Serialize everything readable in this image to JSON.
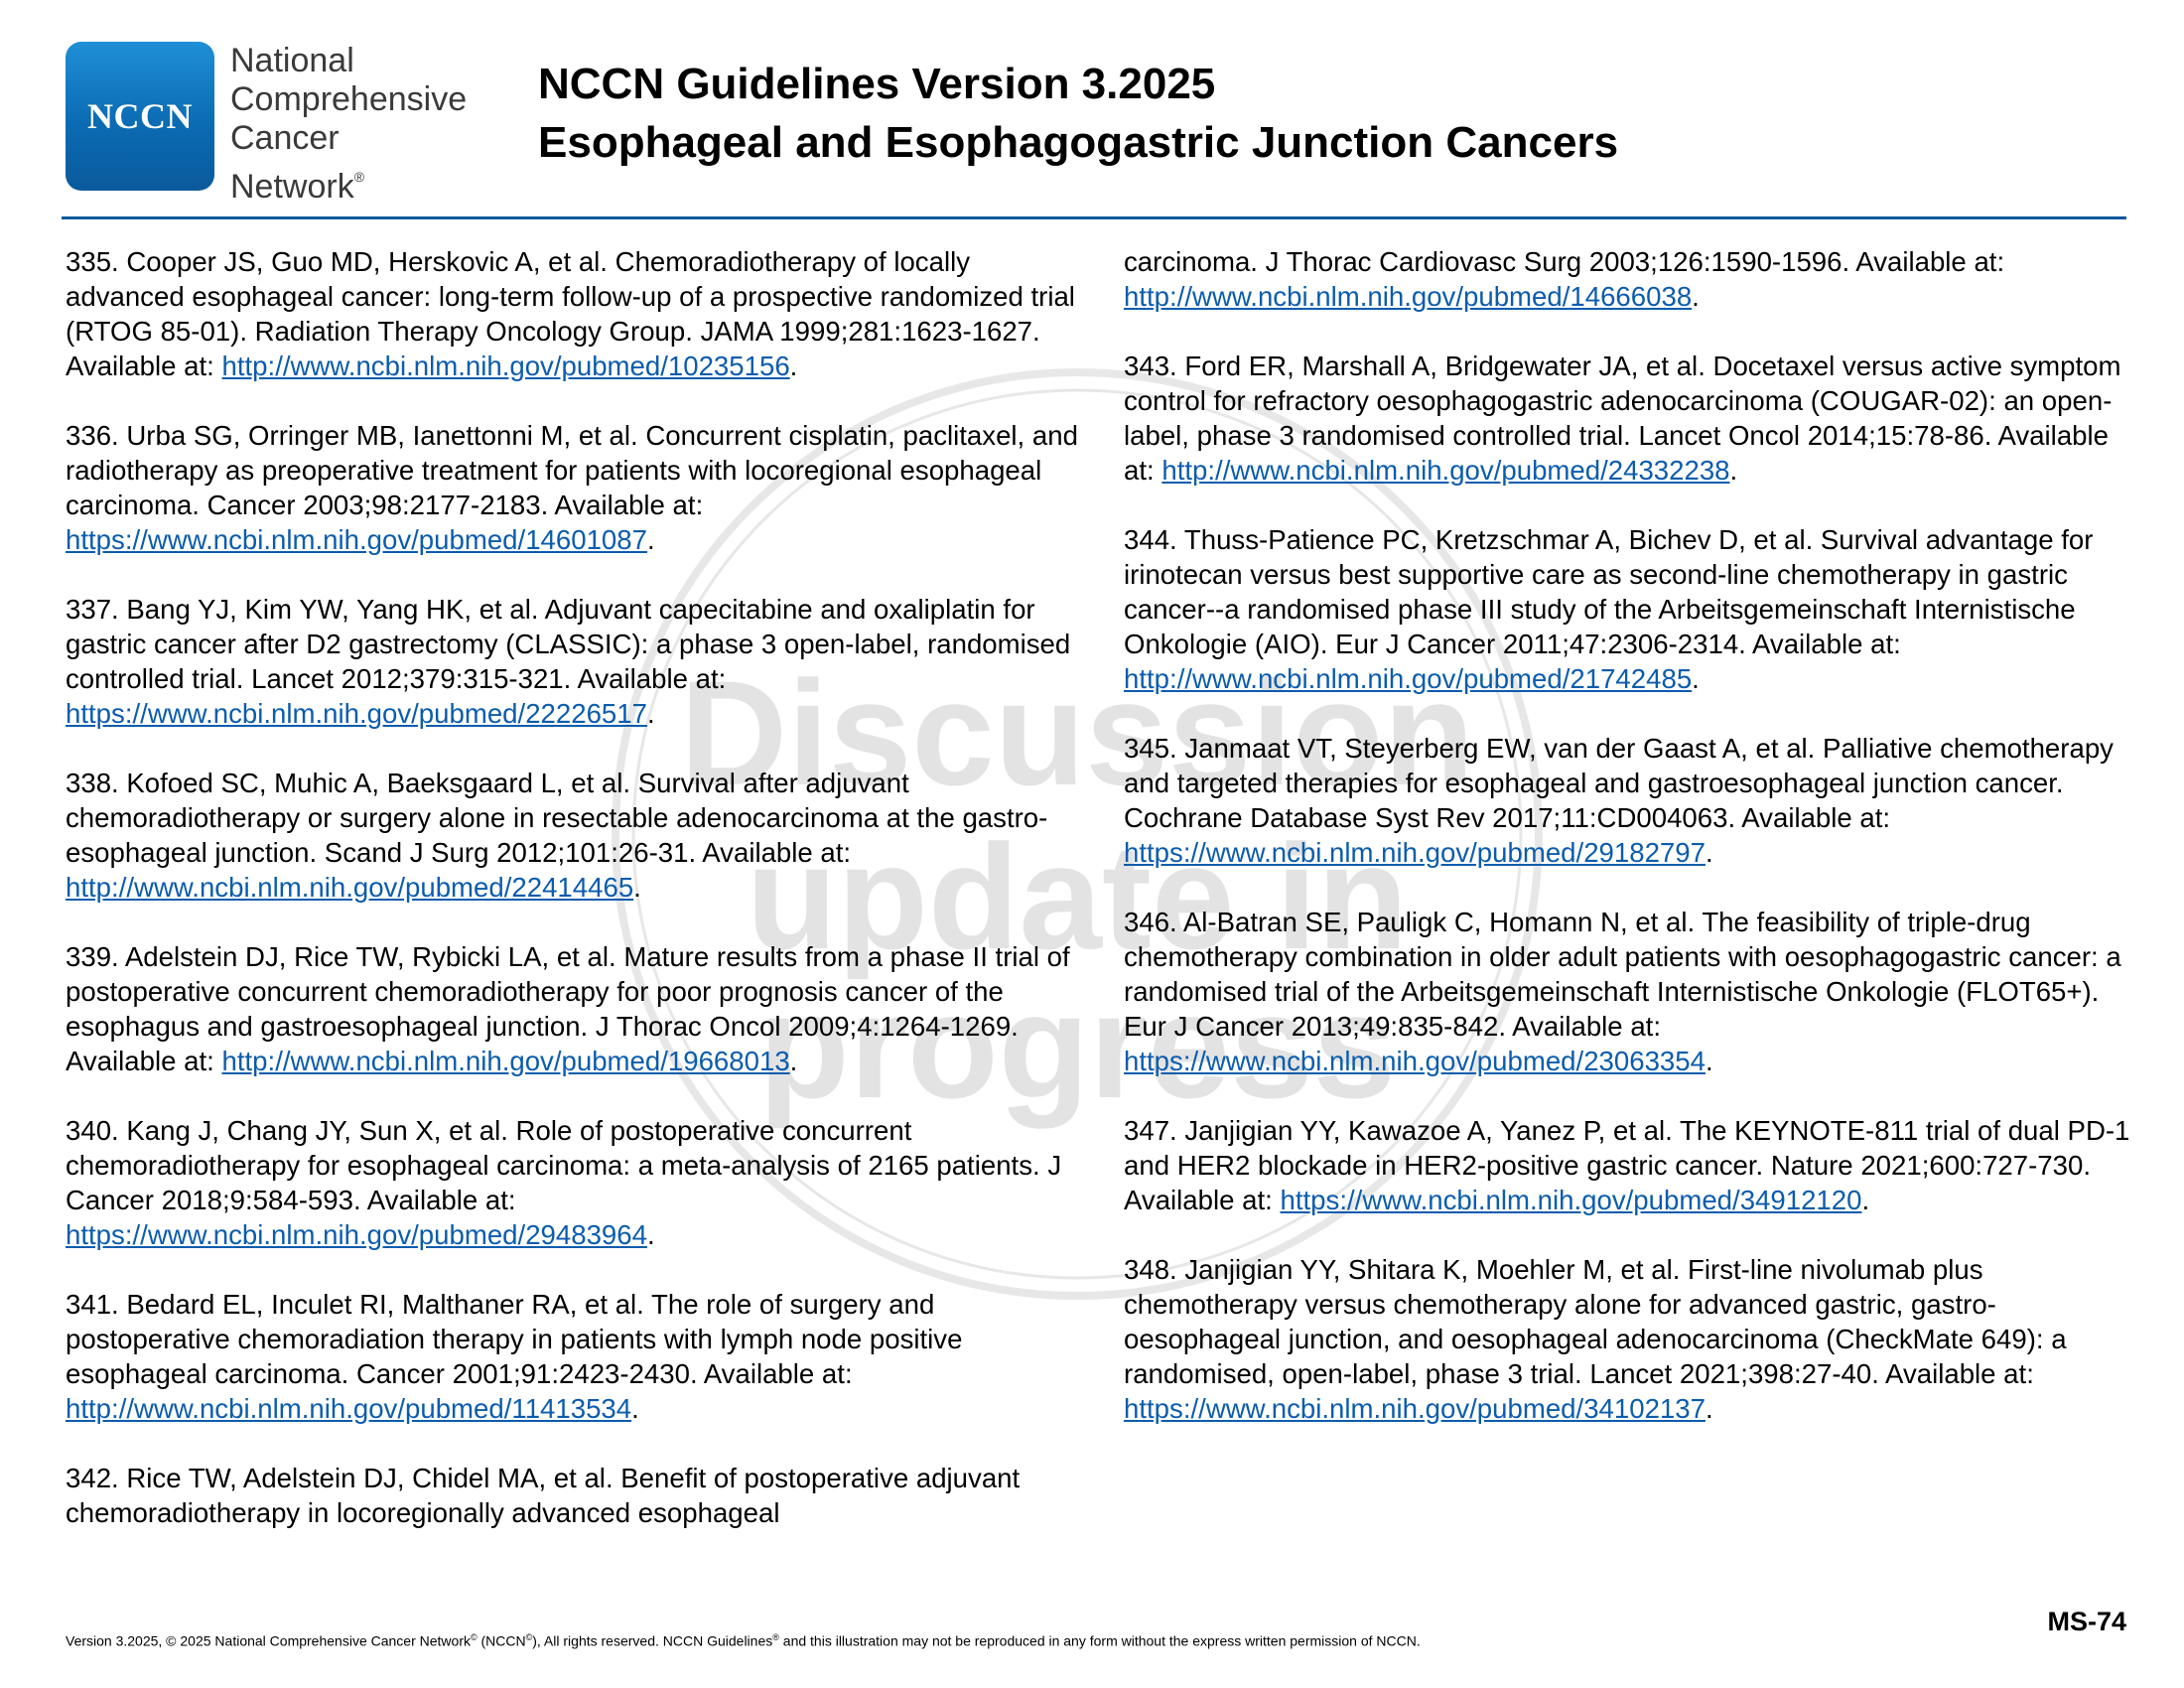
{
  "header": {
    "logo_text": "NCCN",
    "org_lines": [
      "National",
      "Comprehensive",
      "Cancer",
      "Network"
    ],
    "org_reg_mark": "®",
    "title_line1": "NCCN Guidelines Version 3.2025",
    "title_line2": "Esophageal and Esophagogastric Junction Cancers"
  },
  "watermark": {
    "lines": [
      "Discussion",
      "update in",
      "progress"
    ]
  },
  "left_column": [
    {
      "text": "335. Cooper JS, Guo MD, Herskovic A, et al. Chemoradiotherapy of locally advanced esophageal cancer: long-term follow-up of a prospective randomized trial (RTOG 85-01). Radiation Therapy Oncology Group. JAMA 1999;281:1623-1627. Available at: ",
      "link": "http://www.ncbi.nlm.nih.gov/pubmed/10235156",
      "end": "."
    },
    {
      "text": "336. Urba SG, Orringer MB, Ianettonni M, et al. Concurrent cisplatin, paclitaxel, and radiotherapy as preoperative treatment for patients with locoregional esophageal carcinoma. Cancer 2003;98:2177-2183. Available at: ",
      "link": "https://www.ncbi.nlm.nih.gov/pubmed/14601087",
      "end": "."
    },
    {
      "text": "337. Bang YJ, Kim YW, Yang HK, et al. Adjuvant capecitabine and oxaliplatin for gastric cancer after D2 gastrectomy (CLASSIC): a phase 3 open-label, randomised controlled trial. Lancet 2012;379:315-321. Available at: ",
      "link": "https://www.ncbi.nlm.nih.gov/pubmed/22226517",
      "end": "."
    },
    {
      "text": "338. Kofoed SC, Muhic A, Baeksgaard L, et al. Survival after adjuvant chemoradiotherapy or surgery alone in resectable adenocarcinoma at the gastro-esophageal junction. Scand J Surg 2012;101:26-31. Available at: ",
      "link": "http://www.ncbi.nlm.nih.gov/pubmed/22414465",
      "end": "."
    },
    {
      "text": "339. Adelstein DJ, Rice TW, Rybicki LA, et al. Mature results from a phase II trial of postoperative concurrent chemoradiotherapy for poor prognosis cancer of the esophagus and gastroesophageal junction. J Thorac Oncol 2009;4:1264-1269. Available at: ",
      "link": "http://www.ncbi.nlm.nih.gov/pubmed/19668013",
      "end": "."
    },
    {
      "text": "340. Kang J, Chang JY, Sun X, et al. Role of postoperative concurrent chemoradiotherapy for esophageal carcinoma: a meta-analysis of 2165 patients. J Cancer 2018;9:584-593. Available at: ",
      "link": "https://www.ncbi.nlm.nih.gov/pubmed/29483964",
      "end": "."
    },
    {
      "text": "341. Bedard EL, Inculet RI, Malthaner RA, et al. The role of surgery and postoperative chemoradiation therapy in patients with lymph node positive esophageal carcinoma. Cancer 2001;91:2423-2430. Available at: ",
      "link": "http://www.ncbi.nlm.nih.gov/pubmed/11413534",
      "end": "."
    },
    {
      "text": "342. Rice TW, Adelstein DJ, Chidel MA, et al. Benefit of postoperative adjuvant chemoradiotherapy in locoregionally advanced esophageal",
      "link": "",
      "end": ""
    }
  ],
  "right_column": [
    {
      "text": "carcinoma. J Thorac Cardiovasc Surg 2003;126:1590-1596. Available at: ",
      "link": "http://www.ncbi.nlm.nih.gov/pubmed/14666038",
      "end": "."
    },
    {
      "text": "343. Ford ER, Marshall A, Bridgewater JA, et al. Docetaxel versus active symptom control for refractory oesophagogastric adenocarcinoma (COUGAR-02): an open-label, phase 3 randomised controlled trial. Lancet Oncol 2014;15:78-86. Available at: ",
      "link": "http://www.ncbi.nlm.nih.gov/pubmed/24332238",
      "end": "."
    },
    {
      "text": "344. Thuss-Patience PC, Kretzschmar A, Bichev D, et al. Survival advantage for irinotecan versus best supportive care as second-line chemotherapy in gastric cancer--a randomised phase III study of the Arbeitsgemeinschaft Internistische Onkologie (AIO). Eur J Cancer 2011;47:2306-2314. Available at: ",
      "link": "http://www.ncbi.nlm.nih.gov/pubmed/21742485",
      "end": "."
    },
    {
      "text": "345. Janmaat VT, Steyerberg EW, van der Gaast A, et al. Palliative chemotherapy and targeted therapies for esophageal and gastroesophageal junction cancer. Cochrane Database Syst Rev 2017;11:CD004063. Available at: ",
      "link": "https://www.ncbi.nlm.nih.gov/pubmed/29182797",
      "end": "."
    },
    {
      "text": "346. Al-Batran SE, Pauligk C, Homann N, et al. The feasibility of triple-drug chemotherapy combination in older adult patients with oesophagogastric cancer: a randomised trial of the Arbeitsgemeinschaft Internistische Onkologie (FLOT65+). Eur J Cancer 2013;49:835-842. Available at: ",
      "link": "https://www.ncbi.nlm.nih.gov/pubmed/23063354",
      "end": "."
    },
    {
      "text": "347. Janjigian YY, Kawazoe A, Yanez P, et al. The KEYNOTE-811 trial of dual PD-1 and HER2 blockade in HER2-positive gastric cancer. Nature 2021;600:727-730. Available at: ",
      "link": "https://www.ncbi.nlm.nih.gov/pubmed/34912120",
      "end": "."
    },
    {
      "text": "348. Janjigian YY, Shitara K, Moehler M, et al. First-line nivolumab plus chemotherapy versus chemotherapy alone for advanced gastric, gastro-oesophageal junction, and oesophageal adenocarcinoma (CheckMate 649): a randomised, open-label, phase 3 trial. Lancet 2021;398:27-40. Available at: ",
      "link": "https://www.ncbi.nlm.nih.gov/pubmed/34102137",
      "end": "."
    }
  ],
  "footer": {
    "part1": "Version 3.2025, © 2025 National Comprehensive Cancer Network",
    "mark1": "©",
    "part2": " (NCCN",
    "mark2": "©",
    "part3": "), All rights reserved. NCCN Guidelines",
    "mark3": "®",
    "part4": " and this illustration may not be reproduced in any form without the express written permission of NCCN."
  },
  "page_number": "MS-74",
  "colors": {
    "brand_blue": "#0b6bb3",
    "link_blue": "#0b5cad",
    "rule_blue": "#0a5a9c",
    "watermark_gray": "#b3b3b3"
  }
}
